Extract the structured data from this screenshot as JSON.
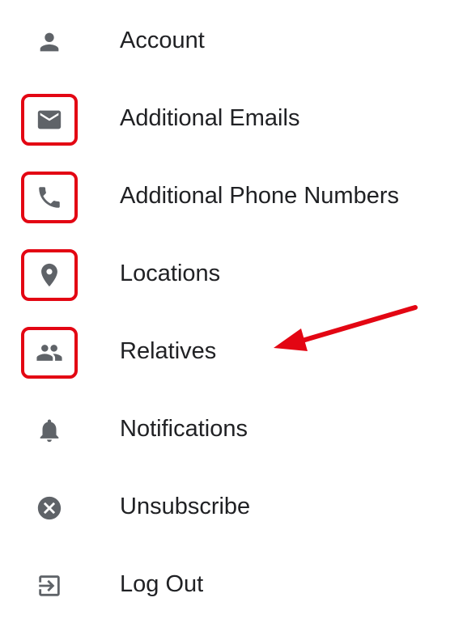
{
  "menu": {
    "items": [
      {
        "label": "Account",
        "icon": "person-icon",
        "highlighted": false
      },
      {
        "label": "Additional Emails",
        "icon": "mail-icon",
        "highlighted": true
      },
      {
        "label": "Additional Phone Numbers",
        "icon": "phone-icon",
        "highlighted": true
      },
      {
        "label": "Locations",
        "icon": "location-pin-icon",
        "highlighted": true
      },
      {
        "label": "Relatives",
        "icon": "people-icon",
        "highlighted": true
      },
      {
        "label": "Notifications",
        "icon": "bell-icon",
        "highlighted": false
      },
      {
        "label": "Unsubscribe",
        "icon": "cancel-circle-icon",
        "highlighted": false
      },
      {
        "label": "Log Out",
        "icon": "logout-icon",
        "highlighted": false
      }
    ]
  },
  "annotation": {
    "highlight_color": "#e30613",
    "arrow_target": "Relatives"
  },
  "colors": {
    "icon": "#5f6368",
    "text": "#202124",
    "background": "#ffffff"
  }
}
